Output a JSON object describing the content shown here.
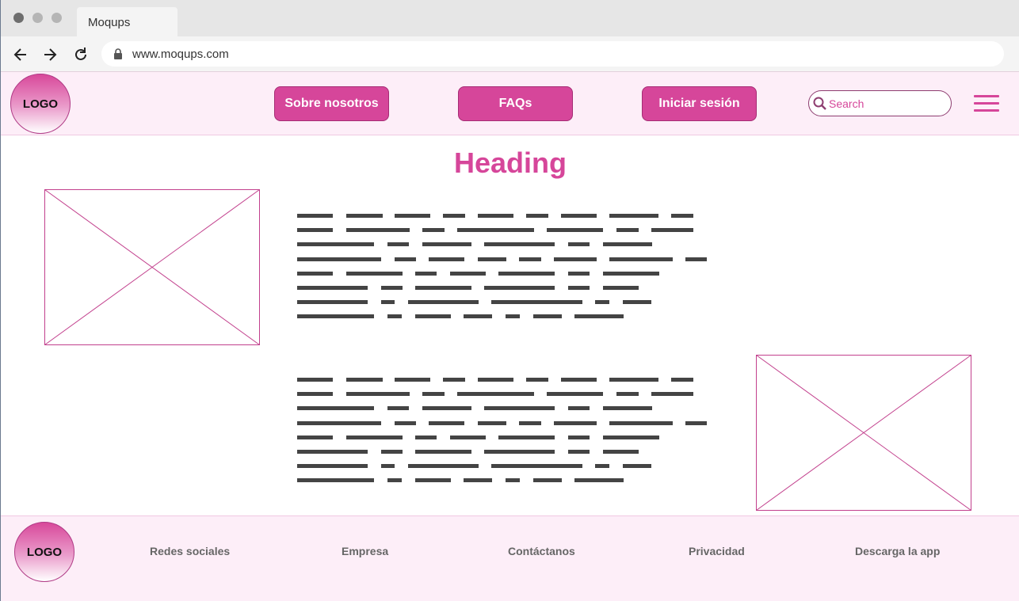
{
  "browser": {
    "tab_title": "Moqups",
    "url": "www.moqups.com"
  },
  "header": {
    "logo": "LOGO",
    "nav": [
      "Sobre nosotros",
      "FAQs",
      "Iniciar sesión"
    ],
    "search_placeholder": "Search"
  },
  "main": {
    "heading": "Heading"
  },
  "footer": {
    "logo": "LOGO",
    "links": [
      "Redes sociales",
      "Empresa",
      "Contáctanos",
      "Privacidad",
      "Descarga la app"
    ]
  },
  "colors": {
    "accent": "#d6469a",
    "header_bg": "#fdeef8",
    "placeholder_text": "#444444"
  },
  "icons": [
    "back-arrow-icon",
    "forward-arrow-icon",
    "reload-icon",
    "lock-icon",
    "search-icon",
    "hamburger-menu-icon",
    "image-placeholder-icon"
  ]
}
